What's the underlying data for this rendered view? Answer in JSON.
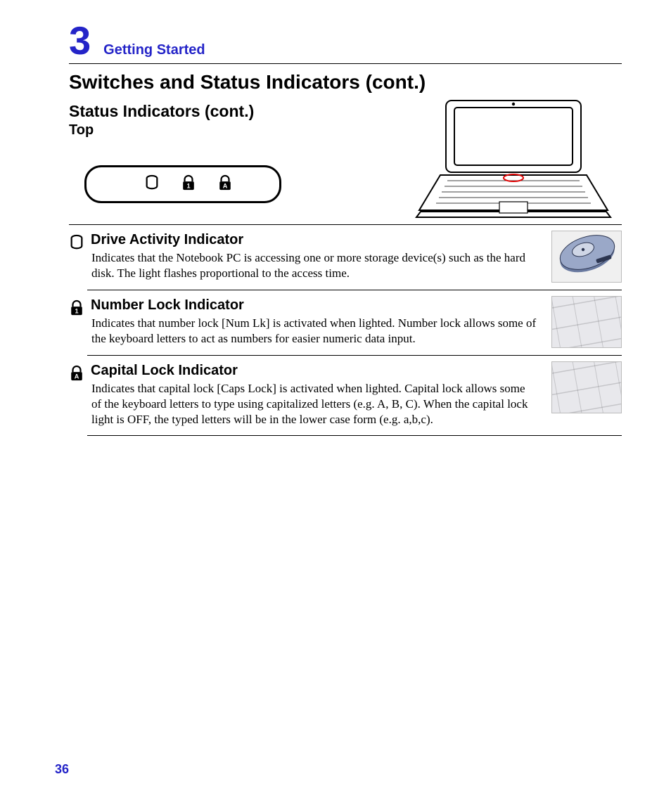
{
  "chapter": {
    "number": "3",
    "label": "Getting Started"
  },
  "title": "Switches and Status Indicators (cont.)",
  "subsection": "Status Indicators (cont.)",
  "subsub": "Top",
  "strip_icons": [
    "cylinder-icon",
    "lock-1-icon",
    "lock-a-icon"
  ],
  "items": [
    {
      "icon": "cylinder-icon",
      "title": "Drive Activity Indicator",
      "body": "Indicates that the Notebook PC is accessing one or more storage device(s) such as the hard disk. The light flashes proportional to the access time.",
      "img": "hdd"
    },
    {
      "icon": "lock-1-icon",
      "title": "Number Lock Indicator",
      "body": "Indicates that number lock [Num Lk] is activated when lighted. Number lock allows some of the  keyboard letters to act as numbers for easier numeric data input.",
      "img": "keyboard"
    },
    {
      "icon": "lock-a-icon",
      "title": "Capital Lock Indicator",
      "body": "Indicates that capital lock [Caps Lock] is activated when lighted. Capital lock allows some of the keyboard letters to type using capitalized letters (e.g. A, B, C). When the capital lock light is OFF, the typed letters will be in the lower case form (e.g. a,b,c).",
      "img": "keyboard"
    }
  ],
  "page_number": "36"
}
